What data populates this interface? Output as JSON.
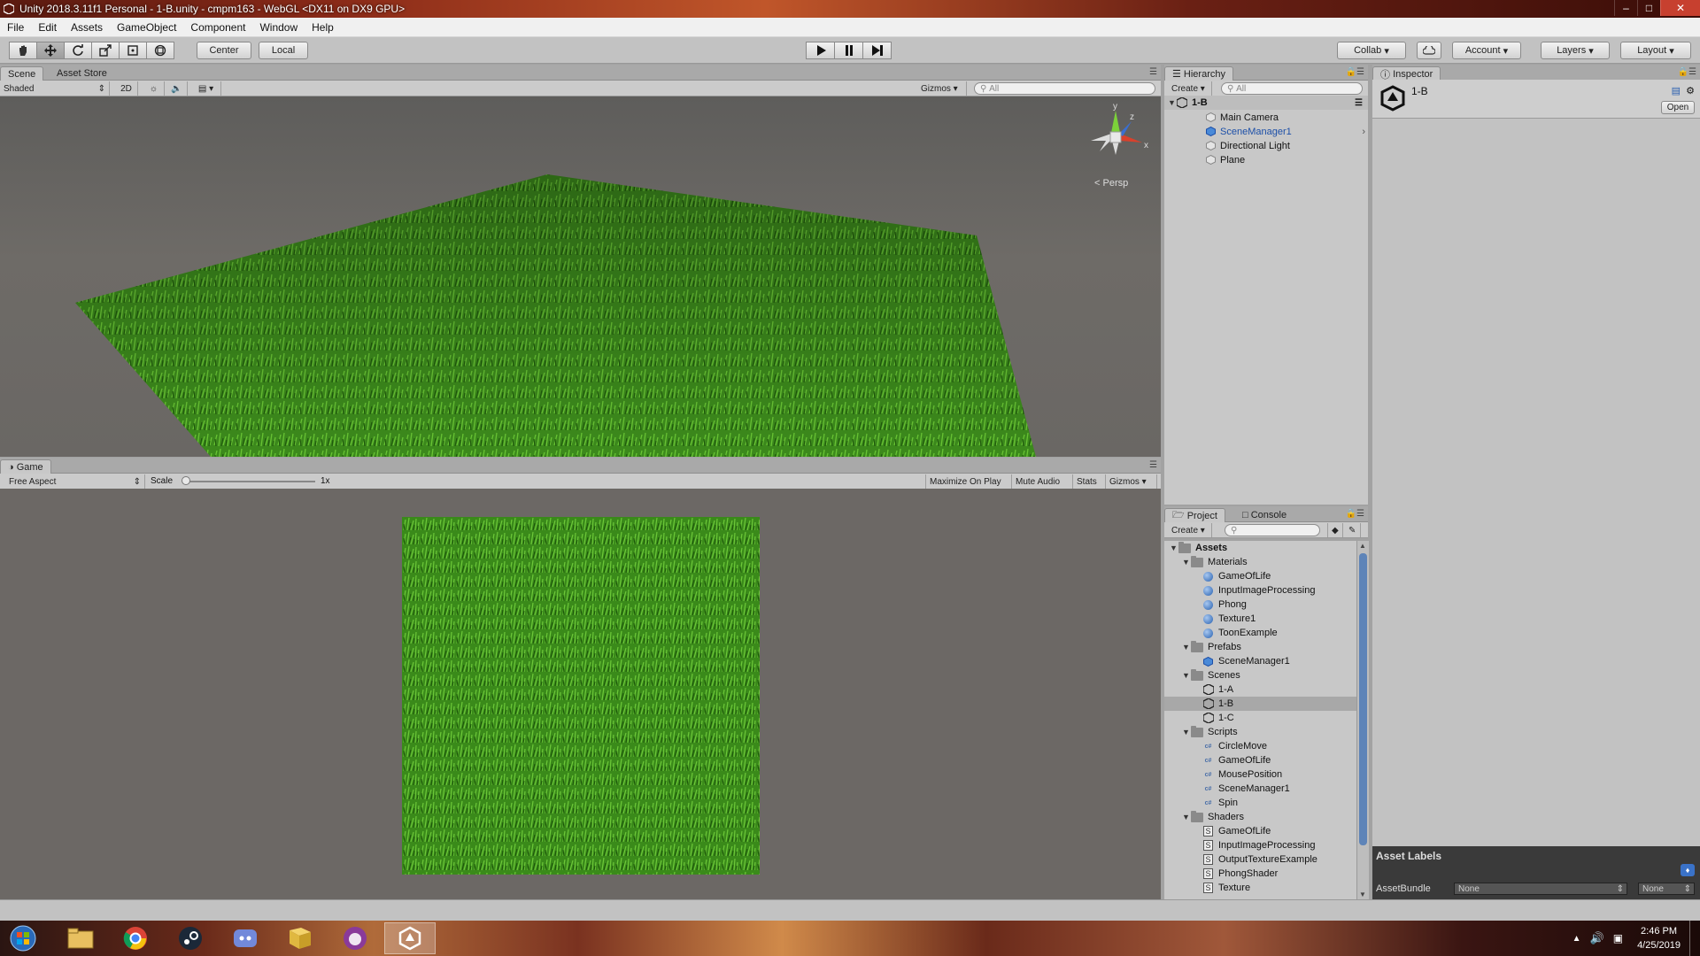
{
  "window": {
    "title": "Unity 2018.3.11f1 Personal - 1-B.unity - cmpm163 - WebGL <DX11 on DX9 GPU>"
  },
  "menu": [
    "File",
    "Edit",
    "Assets",
    "GameObject",
    "Component",
    "Window",
    "Help"
  ],
  "toolbar": {
    "pivot_label": "Center",
    "space_label": "Local",
    "collab_label": "Collab",
    "account_label": "Account",
    "layers_label": "Layers",
    "layout_label": "Layout"
  },
  "scene": {
    "tab": "Scene",
    "asset_store_tab": "Asset Store",
    "shading": "Shaded",
    "mode_2d": "2D",
    "gizmos": "Gizmos",
    "search_placeholder": "All",
    "persp_label": "Persp",
    "axis_y": "y",
    "axis_x": "x",
    "axis_z": "z"
  },
  "game": {
    "tab": "Game",
    "aspect": "Free Aspect",
    "scale_label": "Scale",
    "scale_value": "1x",
    "maximize": "Maximize On Play",
    "mute": "Mute Audio",
    "stats": "Stats",
    "gizmos": "Gizmos"
  },
  "hierarchy": {
    "tab": "Hierarchy",
    "create": "Create",
    "search_placeholder": "All",
    "scene_name": "1-B",
    "items": [
      "Main Camera",
      "SceneManager1",
      "Directional Light",
      "Plane"
    ]
  },
  "inspector": {
    "tab": "Inspector",
    "asset_name": "1-B",
    "open": "Open",
    "asset_labels": "Asset Labels",
    "asset_bundle": "AssetBundle",
    "bundle_value": "None",
    "variant_value": "None"
  },
  "project": {
    "tab": "Project",
    "console_tab": "Console",
    "create": "Create",
    "root": "Assets",
    "folders": [
      {
        "name": "Materials",
        "items": [
          "GameOfLife",
          "InputImageProcessing",
          "Phong",
          "Texture1",
          "ToonExample"
        ]
      },
      {
        "name": "Prefabs",
        "items": [
          "SceneManager1"
        ]
      },
      {
        "name": "Scenes",
        "items": [
          "1-A",
          "1-B",
          "1-C"
        ]
      },
      {
        "name": "Scripts",
        "items": [
          "CircleMove",
          "GameOfLife",
          "MousePosition",
          "SceneManager1",
          "Spin"
        ]
      },
      {
        "name": "Shaders",
        "items": [
          "GameOfLife",
          "InputImageProcessing",
          "OutputTextureExample",
          "PhongShader",
          "Texture"
        ]
      }
    ]
  },
  "taskbar": {
    "time": "2:46 PM",
    "date": "4/25/2019"
  },
  "colors": {
    "accent": "#3a72c8",
    "grass": "#3f8f1f",
    "selection": "#a8a8a8"
  }
}
